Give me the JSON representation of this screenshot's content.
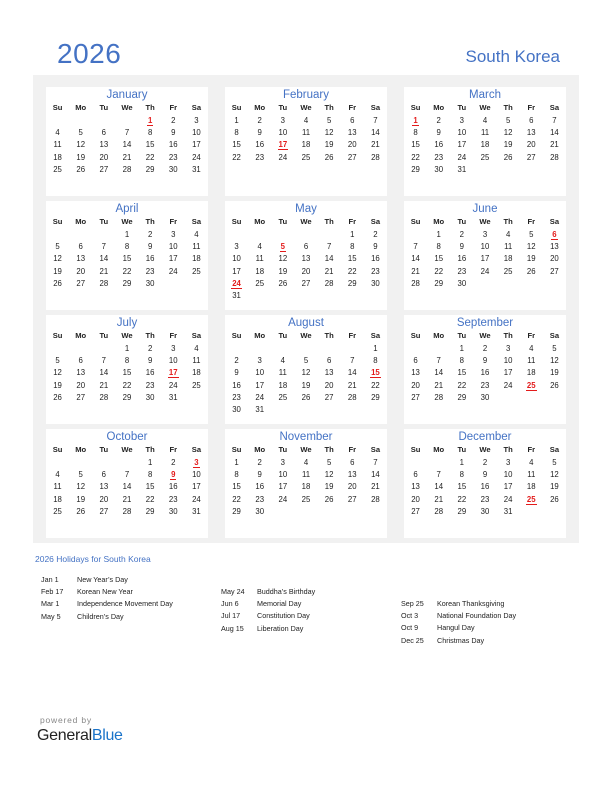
{
  "header": {
    "year": "2026",
    "country": "South Korea"
  },
  "colors": {
    "accent": "#4472c4",
    "holiday": "#e31b1b",
    "panel_bg": "#f1f1f1",
    "brand_blue": "#1a73c9"
  },
  "weekdays": [
    "Su",
    "Mo",
    "Tu",
    "We",
    "Th",
    "Fr",
    "Sa"
  ],
  "months": [
    {
      "name": "January",
      "start": 4,
      "days": 31,
      "holidays": [
        1
      ]
    },
    {
      "name": "February",
      "start": 0,
      "days": 28,
      "holidays": [
        17
      ]
    },
    {
      "name": "March",
      "start": 0,
      "days": 31,
      "holidays": [
        1
      ]
    },
    {
      "name": "April",
      "start": 3,
      "days": 30,
      "holidays": []
    },
    {
      "name": "May",
      "start": 5,
      "days": 31,
      "holidays": [
        5,
        24
      ]
    },
    {
      "name": "June",
      "start": 1,
      "days": 30,
      "holidays": [
        6
      ]
    },
    {
      "name": "July",
      "start": 3,
      "days": 31,
      "holidays": [
        17
      ]
    },
    {
      "name": "August",
      "start": 6,
      "days": 31,
      "holidays": [
        15
      ]
    },
    {
      "name": "September",
      "start": 2,
      "days": 30,
      "holidays": [
        25
      ]
    },
    {
      "name": "October",
      "start": 4,
      "days": 31,
      "holidays": [
        3,
        9
      ]
    },
    {
      "name": "November",
      "start": 0,
      "days": 30,
      "holidays": []
    },
    {
      "name": "December",
      "start": 2,
      "days": 31,
      "holidays": [
        25
      ]
    }
  ],
  "holidays_section": {
    "title": "2026 Holidays for South Korea",
    "columns": [
      [
        {
          "date": "Jan 1",
          "name": "New Year’s Day"
        },
        {
          "date": "Feb 17",
          "name": "Korean New Year"
        },
        {
          "date": "Mar 1",
          "name": "Independence Movement Day"
        },
        {
          "date": "May 5",
          "name": "Children’s Day"
        }
      ],
      [
        {
          "date": "May 24",
          "name": "Buddha’s Birthday"
        },
        {
          "date": "Jun 6",
          "name": "Memorial Day"
        },
        {
          "date": "Jul 17",
          "name": "Constitution Day"
        },
        {
          "date": "Aug 15",
          "name": "Liberation Day"
        }
      ],
      [
        {
          "date": "Sep 25",
          "name": "Korean Thanksgiving"
        },
        {
          "date": "Oct 3",
          "name": "National Foundation Day"
        },
        {
          "date": "Oct 9",
          "name": "Hangul Day"
        },
        {
          "date": "Dec 25",
          "name": "Christmas Day"
        }
      ]
    ]
  },
  "footer": {
    "powered_by": "powered by",
    "brand_part1": "General",
    "brand_part2": "Blue"
  }
}
